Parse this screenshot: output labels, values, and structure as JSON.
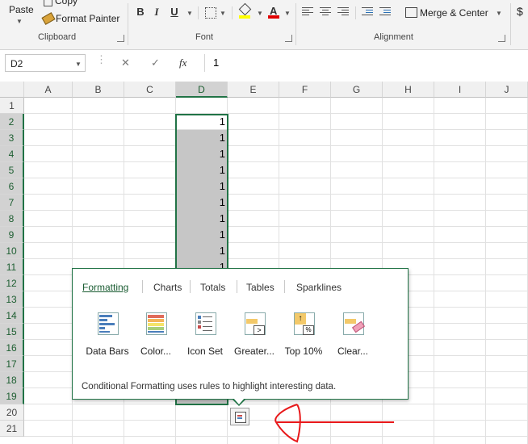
{
  "ribbon": {
    "clipboard": {
      "paste": "Paste",
      "copy": "Copy",
      "format_painter": "Format Painter",
      "group": "Clipboard"
    },
    "font": {
      "group": "Font",
      "bold": "B",
      "italic": "I",
      "underline": "U",
      "font_color_glyph": "A"
    },
    "alignment": {
      "merge_center": "Merge & Center",
      "group": "Alignment"
    },
    "number": {
      "currency": "$"
    }
  },
  "formula_bar": {
    "name_box": "D2",
    "fx": "fx",
    "cancel": "✕",
    "enter": "✓",
    "value": "1"
  },
  "sheet": {
    "columns": [
      "A",
      "B",
      "C",
      "D",
      "E",
      "F",
      "G",
      "H",
      "I",
      "J"
    ],
    "rows": [
      "1",
      "2",
      "3",
      "4",
      "5",
      "6",
      "7",
      "8",
      "9",
      "10",
      "11",
      "12",
      "13",
      "14",
      "15",
      "16",
      "17",
      "18",
      "19",
      "20",
      "21"
    ],
    "cells_d": [
      "1",
      "1",
      "1",
      "1",
      "1",
      "1",
      "1",
      "1",
      "1",
      "1"
    ]
  },
  "quick_analysis": {
    "tabs": [
      "Formatting",
      "Charts",
      "Totals",
      "Tables",
      "Sparklines"
    ],
    "items": [
      "Data Bars",
      "Color...",
      "Icon Set",
      "Greater...",
      "Top 10%",
      "Clear..."
    ],
    "description": "Conditional Formatting uses rules to highlight interesting data.",
    "top_badge": "%"
  },
  "colors": {
    "accent": "#217346",
    "annotation": "#e8181a"
  }
}
